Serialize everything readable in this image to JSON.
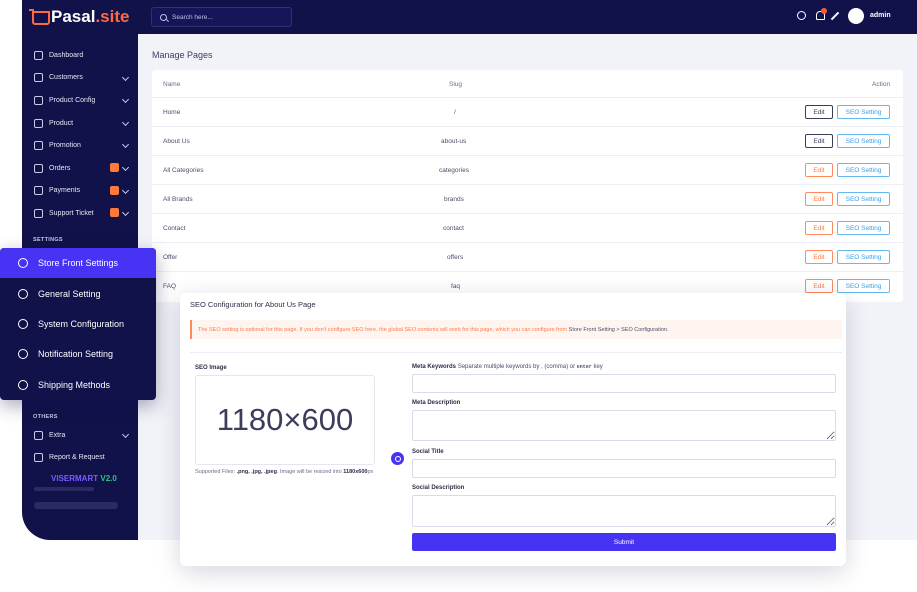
{
  "app": {
    "logo_text": "Pasal",
    "logo_suffix": ".site",
    "brand_version_name": "VISERMART",
    "brand_version_num": "V2.0"
  },
  "topbar": {
    "search_placeholder": "Search here...",
    "user_name": "admin"
  },
  "sidebar": {
    "items": [
      {
        "label": "Dashboard"
      },
      {
        "label": "Customers"
      },
      {
        "label": "Product Config"
      },
      {
        "label": "Product"
      },
      {
        "label": "Promotion"
      },
      {
        "label": "Orders"
      },
      {
        "label": "Payments"
      },
      {
        "label": "Support Ticket"
      }
    ],
    "settings_label": "SETTINGS",
    "others_label": "OTHERS",
    "others_items": [
      {
        "label": "Extra"
      },
      {
        "label": "Report & Request"
      }
    ]
  },
  "overlay_menu": {
    "items": [
      {
        "label": "Store Front Settings"
      },
      {
        "label": "General Setting"
      },
      {
        "label": "System Configuration"
      },
      {
        "label": "Notification Setting"
      },
      {
        "label": "Shipping Methods"
      }
    ]
  },
  "pages": {
    "title": "Manage Pages",
    "columns": {
      "name": "Name",
      "slug": "Slug",
      "action": "Action"
    },
    "edit_label": "Edit",
    "seo_label": "SEO Setting",
    "rows": [
      {
        "name": "Home",
        "slug": "/"
      },
      {
        "name": "About Us",
        "slug": "about-us"
      },
      {
        "name": "All Categories",
        "slug": "categories"
      },
      {
        "name": "All Brands",
        "slug": "brands"
      },
      {
        "name": "Contact",
        "slug": "contact"
      },
      {
        "name": "Offer",
        "slug": "offers"
      },
      {
        "name": "FAQ",
        "slug": "faq"
      }
    ]
  },
  "seo_modal": {
    "title": "SEO Configuration for About Us Page",
    "alert_text": "The SEO setting is optional for this page. If you don't configure SEO here, the global SEO contents will work for this page, which you can configure from",
    "alert_link": "Store Front Setting > SEO Configuration.",
    "seo_image_label": "SEO Image",
    "image_placeholder": "1180×600",
    "supported_prefix": "Supported Files:",
    "supported_types": ".png, .jpg, .jpeg",
    "supported_mid": ". Image will be resized into",
    "supported_size": "1180x600",
    "supported_unit": "px",
    "meta_keywords_label": "Meta Keywords",
    "meta_keywords_hint": "Separate multiple keywords by",
    "meta_keywords_comma": ", (comma) or",
    "meta_keywords_enter": "enter",
    "meta_keywords_key": "key",
    "meta_description_label": "Meta Description",
    "social_title_label": "Social Title",
    "social_description_label": "Social Description",
    "submit_label": "Submit"
  },
  "colors": {
    "sidebar": "#11124a",
    "accent": "#4733f4",
    "warning": "#ff7a46",
    "info": "#3aa0e8"
  }
}
